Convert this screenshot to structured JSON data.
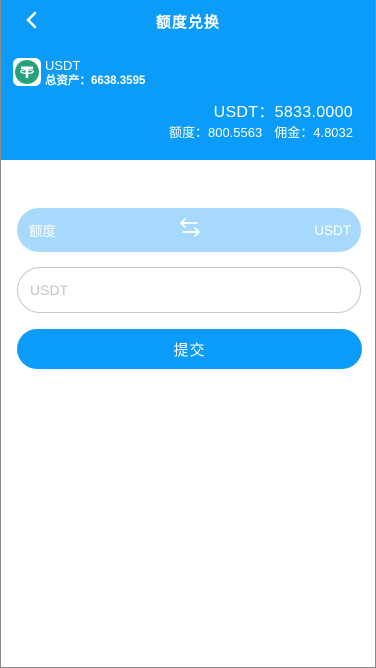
{
  "nav": {
    "back_icon": "chevron-left-icon",
    "title": "额度兑换"
  },
  "account": {
    "coin_icon": "tether-icon",
    "coin_name": "USDT",
    "total_assets_label": "总资产：",
    "total_assets_value": "6638.3595",
    "balance_label": "USDT：",
    "balance_value": "5833.0000",
    "quota_label": "额度：",
    "quota_value": "800.5563",
    "commission_label": "佣金：",
    "commission_value": "4.8032"
  },
  "exchange": {
    "from": "额度",
    "to": "USDT",
    "swap_icon": "swap-arrows-icon",
    "amount_placeholder": "USDT",
    "amount_value": "",
    "submit_label": "提交"
  },
  "colors": {
    "primary": "#0a9cf8",
    "swap_bar": "#a6d9fb",
    "tether_green": "#26a17b"
  }
}
